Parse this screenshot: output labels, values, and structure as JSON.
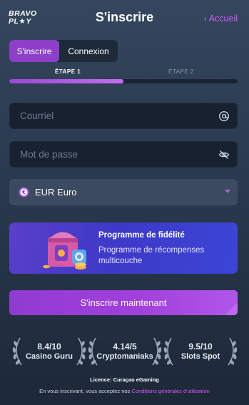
{
  "header": {
    "logo_line1": "BRAVO",
    "logo_line2": "PL★Y",
    "title": "S'inscrire",
    "back_label": "Accueil"
  },
  "tabs": [
    {
      "label": "S'inscrire",
      "active": true
    },
    {
      "label": "Connexion",
      "active": false
    }
  ],
  "steps": {
    "step1": "ÉTAPE 1",
    "step2": "ÉTAPE 2",
    "progress": 0.5
  },
  "form": {
    "email_placeholder": "Courriel",
    "password_placeholder": "Mot de passe",
    "currency_value": "EUR Euro"
  },
  "loyalty": {
    "title": "Programme de fidélité",
    "description": "Programme de récompenses multicouche"
  },
  "cta_label": "S'inscrire maintenant",
  "ratings": [
    {
      "score": "8.4/10",
      "site": "Casino Guru"
    },
    {
      "score": "4.14/5",
      "site": "Cryptomaniaks"
    },
    {
      "score": "9.5/10",
      "site": "Slots Spot"
    }
  ],
  "license": "Licence: Curaçao eGaming",
  "terms": {
    "prefix": "En vous inscrivant, vous acceptez nos",
    "link": "Conditions générales d'utilisation"
  },
  "icons": {
    "email": "at-sign-icon",
    "password": "eye-off-icon",
    "currency": "euro-coin-icon",
    "select": "caret-down-icon",
    "back": "chevron-left-icon"
  },
  "colors": {
    "accent": "#d957ff",
    "button": "#a23fdc",
    "loyalty_banner": "#3e39c8"
  }
}
